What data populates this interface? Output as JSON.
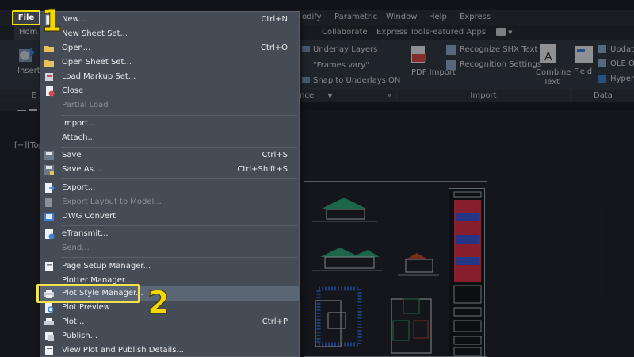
{
  "menubar": {
    "file_label": "File",
    "items": [
      "odify",
      "Parametric",
      "Window",
      "Help",
      "Express"
    ]
  },
  "tabs": {
    "home_label": "Hom",
    "items": [
      "Collaborate",
      "Express Tools",
      "Featured Apps"
    ]
  },
  "ribbon": {
    "insert_label": "Insert",
    "reference": {
      "underlay_layers": "Underlay Layers",
      "frames_vary": "\"Frames vary\"",
      "snap_underlays": "Snap to Underlays ON",
      "footer": "ence"
    },
    "import_panel": {
      "pdf_import": "PDF Import",
      "recognize_shx": "Recognize SHX Text",
      "recognition_settings": "Recognition Settings",
      "combine_text": "Combine Text",
      "footer": "Import"
    },
    "data_panel": {
      "field": "Field",
      "update": "Update",
      "ole": "OLE O",
      "hyperlink": "Hyperl",
      "footer": "Data"
    },
    "left_footer_fragment": "E",
    "left_fragment_2": "S"
  },
  "viewport": {
    "label": "[−][Top"
  },
  "file_menu": {
    "items": [
      {
        "label": "New...",
        "shortcut": "Ctrl+N",
        "disabled": false
      },
      {
        "label": "New Sheet Set...",
        "shortcut": "",
        "disabled": false
      },
      {
        "label": "Open...",
        "shortcut": "Ctrl+O",
        "disabled": false
      },
      {
        "label": "Open Sheet Set...",
        "shortcut": "",
        "disabled": false
      },
      {
        "label": "Load Markup Set...",
        "shortcut": "",
        "disabled": false
      },
      {
        "label": "Close",
        "shortcut": "",
        "disabled": false
      },
      {
        "label": "Partial Load",
        "shortcut": "",
        "disabled": true
      },
      {
        "label": "Import...",
        "shortcut": "",
        "disabled": false
      },
      {
        "label": "Attach...",
        "shortcut": "",
        "disabled": false
      },
      {
        "label": "Save",
        "shortcut": "Ctrl+S",
        "disabled": false
      },
      {
        "label": "Save As...",
        "shortcut": "Ctrl+Shift+S",
        "disabled": false
      },
      {
        "label": "Export...",
        "shortcut": "",
        "disabled": false
      },
      {
        "label": "Export Layout to Model...",
        "shortcut": "",
        "disabled": true
      },
      {
        "label": "DWG Convert",
        "shortcut": "",
        "disabled": false
      },
      {
        "label": "eTransmit...",
        "shortcut": "",
        "disabled": false
      },
      {
        "label": "Send...",
        "shortcut": "",
        "disabled": true
      },
      {
        "label": "Page Setup Manager...",
        "shortcut": "",
        "disabled": false
      },
      {
        "label": "Plotter Manager...",
        "shortcut": "",
        "disabled": false
      },
      {
        "label": "Plot Style Manager...",
        "shortcut": "",
        "disabled": false
      },
      {
        "label": "Plot Preview",
        "shortcut": "",
        "disabled": false
      },
      {
        "label": "Plot...",
        "shortcut": "Ctrl+P",
        "disabled": false
      },
      {
        "label": "Publish...",
        "shortcut": "",
        "disabled": false
      },
      {
        "label": "View Plot and Publish Details...",
        "shortcut": "",
        "disabled": false
      }
    ]
  },
  "steps": {
    "one": "1",
    "two": "2"
  },
  "colors": {
    "highlight": "#f5e24a",
    "step_number": "#f3d800",
    "menu_bg": "#464c55",
    "app_bg": "#1b1f26"
  }
}
